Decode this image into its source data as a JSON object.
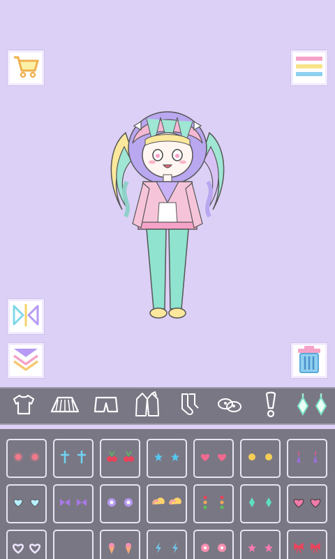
{
  "toolbar": {
    "shop_icon": "shopping-cart-icon",
    "menu_icon": "hamburger-menu-icon",
    "flip_icon": "flip-horizontal-icon",
    "layer_icon": "layer-down-icon",
    "trash_icon": "trash-can-icon"
  },
  "categories": [
    {
      "id": "tops",
      "icon": "t-shirt-icon"
    },
    {
      "id": "skirts",
      "icon": "skirt-icon"
    },
    {
      "id": "shorts",
      "icon": "shorts-icon"
    },
    {
      "id": "outerwear",
      "icon": "jacket-icon"
    },
    {
      "id": "socks",
      "icon": "socks-icon"
    },
    {
      "id": "shoes",
      "icon": "shoes-icon"
    },
    {
      "id": "accessories",
      "icon": "exclamation-icon"
    },
    {
      "id": "earrings",
      "icon": "earrings-icon",
      "selected": true
    }
  ],
  "items": [
    {
      "icon": "red-dot-earrings-icon",
      "color": "#f07a8a"
    },
    {
      "icon": "blue-cross-earrings-icon",
      "color": "#6fd3f0"
    },
    {
      "icon": "cherry-earrings-icon",
      "color": "#e8435a"
    },
    {
      "icon": "blue-star-earrings-icon",
      "color": "#55c8f0"
    },
    {
      "icon": "pink-heart-earrings-icon",
      "color": "#f06a90"
    },
    {
      "icon": "yellow-dot-earrings-icon",
      "color": "#f5cf55"
    },
    {
      "icon": "triangle-drop-earrings-icon",
      "color": "#9a6fd8"
    },
    {
      "icon": "pastel-heart-earrings-icon",
      "color": "#b6f0ff"
    },
    {
      "icon": "bow-earrings-icon",
      "color": "#a878e8"
    },
    {
      "icon": "flower-earrings-icon",
      "color": "#b69af5"
    },
    {
      "icon": "rainbow-cloud-earrings-icon",
      "color": "#ffd36b"
    },
    {
      "icon": "dangle-bead-earrings-icon",
      "color": "#f6a85a"
    },
    {
      "icon": "diamond-earrings-icon",
      "color": "#5ee0c0"
    },
    {
      "icon": "pink-heart-outline-earrings-icon",
      "color": "#f07aa8"
    },
    {
      "icon": "heart-outline-earrings-icon",
      "color": "#efe6ff"
    },
    {
      "icon": "moon-earrings-icon",
      "color": "#f5cf55"
    },
    {
      "icon": "ice-cream-earrings-icon",
      "color": "#f8a878"
    },
    {
      "icon": "lightning-earrings-icon",
      "color": "#6fc8f0"
    },
    {
      "icon": "pink-flower-earrings-icon",
      "color": "#f590b0"
    },
    {
      "icon": "pink-star-earrings-icon",
      "color": "#f77ab0"
    },
    {
      "icon": "ribbon-earrings-icon",
      "color": "#e8435a"
    }
  ],
  "colors": {
    "background": "#dcd0f6",
    "panel": "#7a7784",
    "accent_pink": "#f5a3c8",
    "accent_yellow": "#f7e48a",
    "accent_blue": "#8fd0f0"
  }
}
